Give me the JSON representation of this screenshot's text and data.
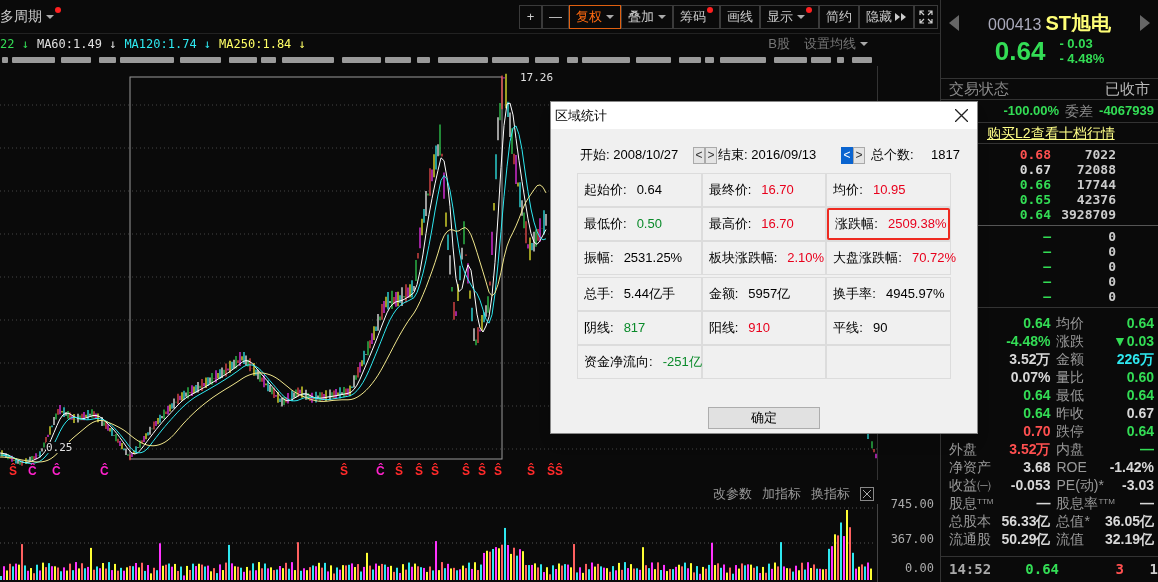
{
  "period_selector": {
    "label": "多周期",
    "dropdown": true,
    "dot": true
  },
  "toolbar": [
    {
      "kind": "text",
      "label": "+",
      "dropdown": false,
      "dot": false,
      "selected": false
    },
    {
      "kind": "text",
      "label": "—",
      "dropdown": false,
      "dot": false,
      "selected": false
    },
    {
      "kind": "text",
      "label": "复权",
      "dropdown": true,
      "dot": false,
      "selected": true
    },
    {
      "kind": "text",
      "label": "叠加",
      "dropdown": true,
      "dot": false,
      "selected": false
    },
    {
      "kind": "text",
      "label": "筹码",
      "dropdown": false,
      "dot": true,
      "selected": false
    },
    {
      "kind": "text",
      "label": "画线",
      "dropdown": false,
      "dot": false,
      "selected": false
    },
    {
      "kind": "text",
      "label": "显示",
      "dropdown": true,
      "dot": true,
      "selected": false
    },
    {
      "kind": "text",
      "label": "简约",
      "dropdown": false,
      "dot": false,
      "selected": false
    },
    {
      "kind": "hide",
      "label": "隐藏",
      "dropdown": false,
      "dot": false,
      "selected": false
    },
    {
      "kind": "fullscreen"
    }
  ],
  "ma_legend": [
    {
      "label": "22",
      "arrow": "↓",
      "color": "#33dd55"
    },
    {
      "label": "MA60:1.49",
      "arrow": "↓",
      "color": "#e0e0e0"
    },
    {
      "label": "MA120:1.74",
      "arrow": "↓",
      "color": "#2ee8f0"
    },
    {
      "label": "MA250:1.84",
      "arrow": "↓",
      "color": "#ffff66"
    }
  ],
  "chart_options": [
    {
      "label": "B股",
      "dropdown": false
    },
    {
      "label": "设置均线",
      "dropdown": true
    }
  ],
  "chart": {
    "high_label": "17.26",
    "low_label": "0.25",
    "markers": [
      {
        "text": "Ŝ",
        "color": "#ff2a2a"
      },
      {
        "text": "Ĉ",
        "color": "#ff22cc"
      },
      {
        "text": "Ĉ",
        "color": "#ff22cc"
      },
      {
        "text": "Ĉ",
        "color": "#ff22cc"
      },
      {
        "text": "Ŝ",
        "color": "#ff2a2a"
      },
      {
        "text": "Ĉ",
        "color": "#ff22cc"
      },
      {
        "text": "Ŝ",
        "color": "#ff2a2a"
      },
      {
        "text": "Ŝ",
        "color": "#ff2a2a"
      },
      {
        "text": "Ŝ",
        "color": "#ff2a2a"
      },
      {
        "text": "Ŝ",
        "color": "#ff2a2a"
      },
      {
        "text": "Ŝ",
        "color": "#ff2a2a"
      },
      {
        "text": "Ŝ",
        "color": "#ff2a2a"
      },
      {
        "text": "Ŝ",
        "color": "#ff2a2a"
      },
      {
        "text": "ŜŜ",
        "color": "#ff2a2a"
      }
    ]
  },
  "volume_panel": {
    "actions": [
      "改参数",
      "加指标",
      "换指标"
    ],
    "axis_labels": [
      "745.00",
      "367.00",
      "0.00"
    ]
  },
  "dialog": {
    "title": "区域统计",
    "start": {
      "label": "开始:",
      "value": "2008/10/27"
    },
    "end": {
      "label": "结束:",
      "value": "2016/09/13"
    },
    "nav": [
      {
        "text": "<",
        "focused": false
      },
      {
        "text": ">",
        "focused": false
      },
      {
        "text": "<",
        "focused": true
      },
      {
        "text": ">",
        "focused": false
      }
    ],
    "count": {
      "label": "总个数:",
      "value": "1817"
    },
    "sections": [
      [
        {
          "label": "起始价:",
          "value": "0.64",
          "color": "#000000",
          "highlighted": false
        },
        {
          "label": "最终价:",
          "value": "16.70",
          "color": "#e8001c",
          "highlighted": false
        },
        {
          "label": "均价:",
          "value": "10.95",
          "color": "#e8001c",
          "highlighted": false
        },
        {
          "label": "最低价:",
          "value": "0.50",
          "color": "#0a8a2a",
          "highlighted": false
        },
        {
          "label": "最高价:",
          "value": "16.70",
          "color": "#e8001c",
          "highlighted": false
        },
        {
          "label": "涨跌幅:",
          "value": "2509.38%",
          "color": "#e8001c",
          "highlighted": true
        },
        {
          "label": "振幅:",
          "value": "2531.25%",
          "color": "#000000",
          "highlighted": false
        },
        {
          "label": "板块涨跌幅:",
          "value": "2.10%",
          "color": "#e8001c",
          "highlighted": false
        },
        {
          "label": "大盘涨跌幅:",
          "value": "70.72%",
          "color": "#e8001c",
          "highlighted": false
        }
      ],
      [
        {
          "label": "总手:",
          "value": "5.44亿手",
          "color": "#000000",
          "highlighted": false
        },
        {
          "label": "金额:",
          "value": "5957亿",
          "color": "#000000",
          "highlighted": false
        },
        {
          "label": "换手率:",
          "value": "4945.97%",
          "color": "#000000",
          "highlighted": false
        },
        {
          "label": "阴线:",
          "value": "817",
          "color": "#0a8a2a",
          "highlighted": false
        },
        {
          "label": "阳线:",
          "value": "910",
          "color": "#e8001c",
          "highlighted": false
        },
        {
          "label": "平线:",
          "value": "90",
          "color": "#000000",
          "highlighted": false
        },
        {
          "label": "资金净流向:",
          "value": "-251亿",
          "color": "#0a8a2a",
          "highlighted": false
        }
      ]
    ],
    "ok_button": "确定"
  },
  "quote": {
    "code": "000413",
    "name": "ST旭电",
    "price": "0.64",
    "change": "- 0.03",
    "change_pct": "- 4.48%",
    "color": "#33dd55",
    "status_label": "交易状态",
    "status": "已收市",
    "ratio": "-100.00%",
    "diff_label": "委差",
    "diff": "-4067939",
    "l2_link": "购买L2查看十档行情",
    "asks": [
      {
        "price": "0.68",
        "volume": "7022",
        "color": "#ff5050"
      },
      {
        "price": "0.67",
        "volume": "72088",
        "color": "#d8d8d8"
      },
      {
        "price": "0.66",
        "volume": "17744",
        "color": "#33dd55"
      },
      {
        "price": "0.65",
        "volume": "42376",
        "color": "#33dd55"
      },
      {
        "price": "0.64",
        "volume": "3928709",
        "color": "#33dd55"
      }
    ],
    "bids": [
      {
        "price": "—",
        "volume": "0",
        "color": "#33dd55"
      },
      {
        "price": "—",
        "volume": "0",
        "color": "#33dd55"
      },
      {
        "price": "—",
        "volume": "0",
        "color": "#33dd55"
      },
      {
        "price": "—",
        "volume": "0",
        "color": "#33dd55"
      },
      {
        "price": "—",
        "volume": "0",
        "color": "#33dd55"
      }
    ],
    "stats": [
      {
        "value": "0.64",
        "color": "#33dd55",
        "right": {
          "label": "均价",
          "value": "0.64",
          "color": "#33dd55"
        }
      },
      {
        "value": "-4.48%",
        "color": "#33dd55",
        "right": {
          "label": "涨跌",
          "value": "▼0.03",
          "color": "#33dd55"
        }
      },
      {
        "value": "3.52万",
        "color": "#d8d8d8",
        "right": {
          "label": "金额",
          "value": "226万",
          "color": "#2ee8f0"
        }
      },
      {
        "value": "0.07%",
        "color": "#d8d8d8",
        "right": {
          "label": "量比",
          "value": "0.60",
          "color": "#33dd55"
        }
      },
      {
        "value": "0.64",
        "color": "#33dd55",
        "right": {
          "label": "最低",
          "value": "0.64",
          "color": "#33dd55"
        }
      },
      {
        "value": "0.64",
        "color": "#33dd55",
        "right": {
          "label": "昨收",
          "value": "0.67",
          "color": "#d8d8d8"
        }
      },
      {
        "value": "0.70",
        "color": "#ff5050",
        "right": {
          "label": "跌停",
          "value": "0.64",
          "color": "#33dd55"
        }
      },
      {
        "label": "外盘",
        "value": "3.52万",
        "color": "#ff5050",
        "right": {
          "label": "内盘",
          "value": "—",
          "color": "#33dd55"
        }
      },
      {
        "label": "净资产",
        "value": "3.68",
        "color": "#d8d8d8",
        "right": {
          "label": "ROE",
          "value": "-1.42%",
          "color": "#d8d8d8"
        }
      },
      {
        "label": "收益㈠",
        "value": "-0.053",
        "color": "#d8d8d8",
        "right": {
          "label": "PE(动)*",
          "value": "-3.03",
          "color": "#d8d8d8"
        }
      },
      {
        "label": "股息$^{TTM}$",
        "value": "—",
        "color": "#d8d8d8",
        "right": {
          "label": "股息率$^{TTM}$",
          "value": "—",
          "color": "#d8d8d8"
        }
      },
      {
        "label": "总股本",
        "value": "56.33亿",
        "color": "#d8d8d8",
        "right": {
          "label": "总值*",
          "value": "36.05亿",
          "color": "#d8d8d8"
        }
      },
      {
        "label": "流通股",
        "value": "50.29亿",
        "color": "#d8d8d8",
        "right": {
          "label": "流值",
          "value": "32.19亿",
          "color": "#d8d8d8"
        }
      }
    ],
    "ticks": [
      {
        "time": "14:52",
        "price": "0.64",
        "volume": "3",
        "count": "1"
      }
    ]
  }
}
